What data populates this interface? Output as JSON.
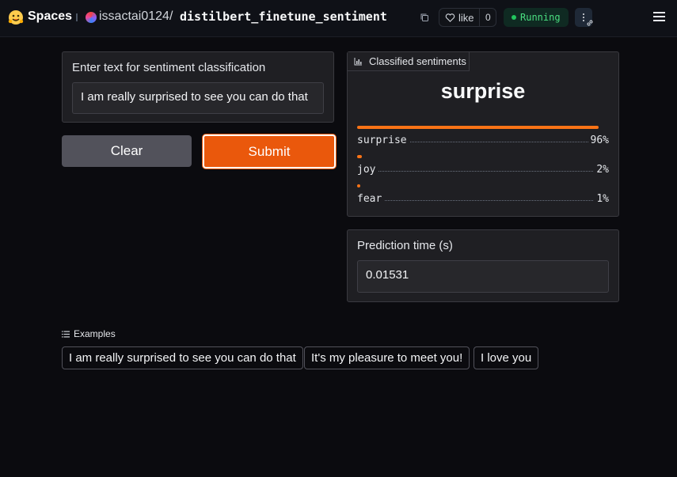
{
  "header": {
    "brand": "Spaces",
    "owner": "issactai0124",
    "slash": "/",
    "repo": "distilbert_finetune_sentiment",
    "like_label": "like",
    "like_count": "0",
    "status": "Running",
    "colors": {
      "status": "#4ade80",
      "brand": "#ffcc4d"
    }
  },
  "input": {
    "label": "Enter text for sentiment classification",
    "value": "I am really surprised to see you can do that"
  },
  "buttons": {
    "clear": "Clear",
    "submit": "Submit",
    "submit_color": "#ea580c"
  },
  "output": {
    "tab_label": "Classified sentiments",
    "top_label": "surprise",
    "confidences": [
      {
        "label": "surprise",
        "value": "96%",
        "fraction": 0.96
      },
      {
        "label": "joy",
        "value": "2%",
        "fraction": 0.02
      },
      {
        "label": "fear",
        "value": "1%",
        "fraction": 0.01
      }
    ]
  },
  "prediction": {
    "label": "Prediction time (s)",
    "value": "0.01531"
  },
  "examples": {
    "title": "Examples",
    "items": [
      "I am really surprised to see you can do that",
      "It's my pleasure to meet you!",
      "I love you"
    ]
  },
  "icons": [
    "hugging-face-logo",
    "copy-icon",
    "heart-icon",
    "more-icon",
    "link-icon",
    "menu-icon",
    "bar-chart-icon",
    "list-icon"
  ]
}
